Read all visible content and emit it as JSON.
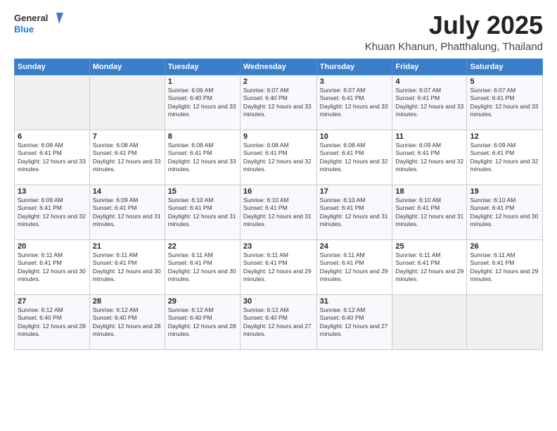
{
  "header": {
    "logo_line1": "General",
    "logo_line2": "Blue",
    "title": "July 2025",
    "subtitle": "Khuan Khanun, Phatthalung, Thailand"
  },
  "weekdays": [
    "Sunday",
    "Monday",
    "Tuesday",
    "Wednesday",
    "Thursday",
    "Friday",
    "Saturday"
  ],
  "weeks": [
    [
      {
        "day": "",
        "info": ""
      },
      {
        "day": "",
        "info": ""
      },
      {
        "day": "1",
        "info": "Sunrise: 6:06 AM\nSunset: 6:40 PM\nDaylight: 12 hours and 33 minutes."
      },
      {
        "day": "2",
        "info": "Sunrise: 6:07 AM\nSunset: 6:40 PM\nDaylight: 12 hours and 33 minutes."
      },
      {
        "day": "3",
        "info": "Sunrise: 6:07 AM\nSunset: 6:41 PM\nDaylight: 12 hours and 33 minutes."
      },
      {
        "day": "4",
        "info": "Sunrise: 6:07 AM\nSunset: 6:41 PM\nDaylight: 12 hours and 33 minutes."
      },
      {
        "day": "5",
        "info": "Sunrise: 6:07 AM\nSunset: 6:41 PM\nDaylight: 12 hours and 33 minutes."
      }
    ],
    [
      {
        "day": "6",
        "info": "Sunrise: 6:08 AM\nSunset: 6:41 PM\nDaylight: 12 hours and 33 minutes."
      },
      {
        "day": "7",
        "info": "Sunrise: 6:08 AM\nSunset: 6:41 PM\nDaylight: 12 hours and 33 minutes."
      },
      {
        "day": "8",
        "info": "Sunrise: 6:08 AM\nSunset: 6:41 PM\nDaylight: 12 hours and 33 minutes."
      },
      {
        "day": "9",
        "info": "Sunrise: 6:08 AM\nSunset: 6:41 PM\nDaylight: 12 hours and 32 minutes."
      },
      {
        "day": "10",
        "info": "Sunrise: 6:08 AM\nSunset: 6:41 PM\nDaylight: 12 hours and 32 minutes."
      },
      {
        "day": "11",
        "info": "Sunrise: 6:09 AM\nSunset: 6:41 PM\nDaylight: 12 hours and 32 minutes."
      },
      {
        "day": "12",
        "info": "Sunrise: 6:09 AM\nSunset: 6:41 PM\nDaylight: 12 hours and 32 minutes."
      }
    ],
    [
      {
        "day": "13",
        "info": "Sunrise: 6:09 AM\nSunset: 6:41 PM\nDaylight: 12 hours and 32 minutes."
      },
      {
        "day": "14",
        "info": "Sunrise: 6:09 AM\nSunset: 6:41 PM\nDaylight: 12 hours and 31 minutes."
      },
      {
        "day": "15",
        "info": "Sunrise: 6:10 AM\nSunset: 6:41 PM\nDaylight: 12 hours and 31 minutes."
      },
      {
        "day": "16",
        "info": "Sunrise: 6:10 AM\nSunset: 6:41 PM\nDaylight: 12 hours and 31 minutes."
      },
      {
        "day": "17",
        "info": "Sunrise: 6:10 AM\nSunset: 6:41 PM\nDaylight: 12 hours and 31 minutes."
      },
      {
        "day": "18",
        "info": "Sunrise: 6:10 AM\nSunset: 6:41 PM\nDaylight: 12 hours and 31 minutes."
      },
      {
        "day": "19",
        "info": "Sunrise: 6:10 AM\nSunset: 6:41 PM\nDaylight: 12 hours and 30 minutes."
      }
    ],
    [
      {
        "day": "20",
        "info": "Sunrise: 6:11 AM\nSunset: 6:41 PM\nDaylight: 12 hours and 30 minutes."
      },
      {
        "day": "21",
        "info": "Sunrise: 6:11 AM\nSunset: 6:41 PM\nDaylight: 12 hours and 30 minutes."
      },
      {
        "day": "22",
        "info": "Sunrise: 6:11 AM\nSunset: 6:41 PM\nDaylight: 12 hours and 30 minutes."
      },
      {
        "day": "23",
        "info": "Sunrise: 6:11 AM\nSunset: 6:41 PM\nDaylight: 12 hours and 29 minutes."
      },
      {
        "day": "24",
        "info": "Sunrise: 6:11 AM\nSunset: 6:41 PM\nDaylight: 12 hours and 29 minutes."
      },
      {
        "day": "25",
        "info": "Sunrise: 6:11 AM\nSunset: 6:41 PM\nDaylight: 12 hours and 29 minutes."
      },
      {
        "day": "26",
        "info": "Sunrise: 6:11 AM\nSunset: 6:41 PM\nDaylight: 12 hours and 29 minutes."
      }
    ],
    [
      {
        "day": "27",
        "info": "Sunrise: 6:12 AM\nSunset: 6:40 PM\nDaylight: 12 hours and 28 minutes."
      },
      {
        "day": "28",
        "info": "Sunrise: 6:12 AM\nSunset: 6:40 PM\nDaylight: 12 hours and 28 minutes."
      },
      {
        "day": "29",
        "info": "Sunrise: 6:12 AM\nSunset: 6:40 PM\nDaylight: 12 hours and 28 minutes."
      },
      {
        "day": "30",
        "info": "Sunrise: 6:12 AM\nSunset: 6:40 PM\nDaylight: 12 hours and 27 minutes."
      },
      {
        "day": "31",
        "info": "Sunrise: 6:12 AM\nSunset: 6:40 PM\nDaylight: 12 hours and 27 minutes."
      },
      {
        "day": "",
        "info": ""
      },
      {
        "day": "",
        "info": ""
      }
    ]
  ]
}
